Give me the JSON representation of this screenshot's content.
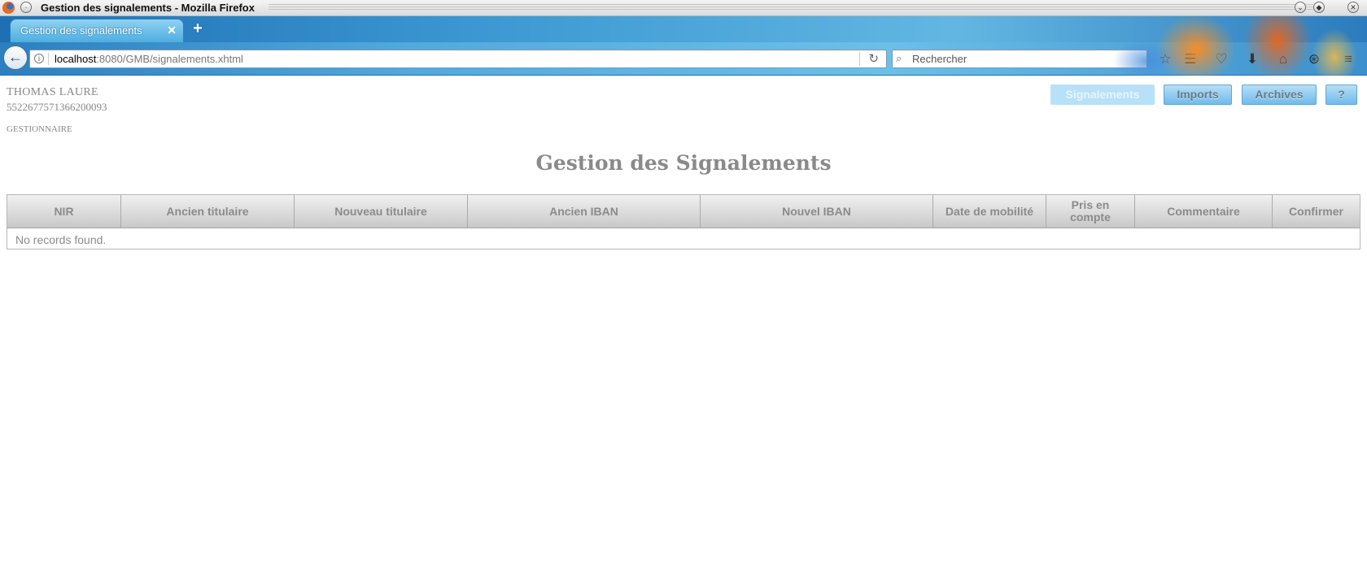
{
  "window": {
    "title": "Gestion des signalements - Mozilla Firefox",
    "controls": [
      "minimize",
      "maximize",
      "close"
    ]
  },
  "browser": {
    "tab_title": "Gestion des signalements",
    "url_host": "localhost",
    "url_rest": ":8080/GMB/signalements.xhtml",
    "search_placeholder": "Rechercher",
    "toolbar_icons": [
      "bookmark-star-icon",
      "reading-list-icon",
      "pocket-icon",
      "download-icon",
      "home-icon",
      "sync-icon",
      "menu-icon"
    ]
  },
  "user": {
    "name": "THOMAS LAURE",
    "id": "5522677571366200093",
    "role": "GESTIONNAIRE"
  },
  "nav": {
    "signalements": "Signalements",
    "imports": "Imports",
    "archives": "Archives",
    "help": "?",
    "current": "Signalements"
  },
  "page": {
    "title": "Gestion des Signalements"
  },
  "table": {
    "columns": [
      "NIR",
      "Ancien titulaire",
      "Nouveau titulaire",
      "Ancien IBAN",
      "Nouvel IBAN",
      "Date de mobilité",
      "Pris en compte",
      "Commentaire",
      "Confirmer"
    ],
    "rows": [],
    "empty_message": "No records found."
  },
  "colors": {
    "button_gradient_top": "#b7dff6",
    "button_gradient_bottom": "#6fbbec",
    "text_gray": "#8b8b8b",
    "browser_blue": "#3b98d2"
  }
}
